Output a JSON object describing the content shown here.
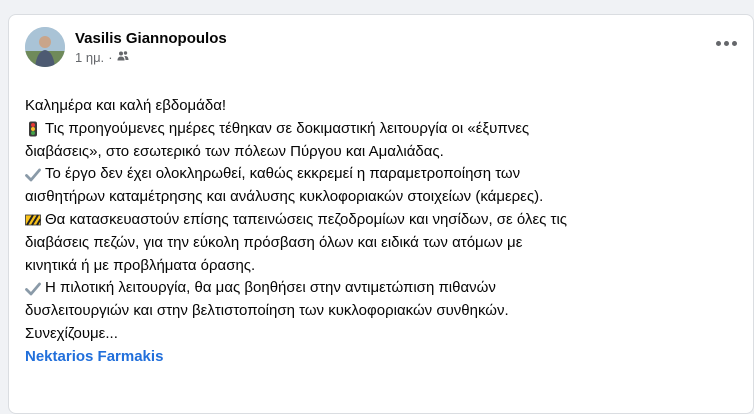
{
  "post": {
    "author": "Vasilis Giannopoulos",
    "time": "1 ημ.",
    "separator": "·",
    "audience_icon": "friends-icon",
    "lines": [
      {
        "emoji": "",
        "text": "Καλημέρα και καλή εβδομάδα!"
      },
      {
        "emoji": "traffic-light-icon",
        "text": "Τις προηγούμενες ημέρες τέθηκαν σε δοκιμαστική λειτουργία οι «έξυπνες"
      },
      {
        "emoji": "",
        "text": "διαβάσεις», στο εσωτερικό των πόλεων Πύργου και Αμαλιάδας."
      },
      {
        "emoji": "check-mark-icon",
        "text": "Το έργο δεν έχει ολοκληρωθεί, καθώς εκκρεμεί η παραμετροποίηση των"
      },
      {
        "emoji": "",
        "text": "αισθητήρων καταμέτρησης και ανάλυσης κυκλοφοριακών στοιχείων (κάμερες)."
      },
      {
        "emoji": "construction-icon",
        "text": "Θα κατασκευαστούν επίσης ταπεινώσεις πεζοδρομίων και νησίδων, σε όλες τις"
      },
      {
        "emoji": "",
        "text": "διαβάσεις πεζών, για την εύκολη πρόσβαση όλων και ειδικά των ατόμων με"
      },
      {
        "emoji": "",
        "text": "κινητικά ή με προβλήματα όρασης."
      },
      {
        "emoji": "check-mark-icon",
        "text": "Η πιλοτική λειτουργία, θα μας βοηθήσει στην αντιμετώπιση πιθανών"
      },
      {
        "emoji": "",
        "text": "δυσλειτουργιών και στην βελτιστοποίηση των κυκλοφοριακών συνθηκών."
      },
      {
        "emoji": "",
        "text": "Συνεχίζουμε..."
      }
    ],
    "mention": "Nektarios Farmakis"
  },
  "colors": {
    "link": "#216fdb",
    "text": "#050505",
    "muted": "#65676b"
  }
}
